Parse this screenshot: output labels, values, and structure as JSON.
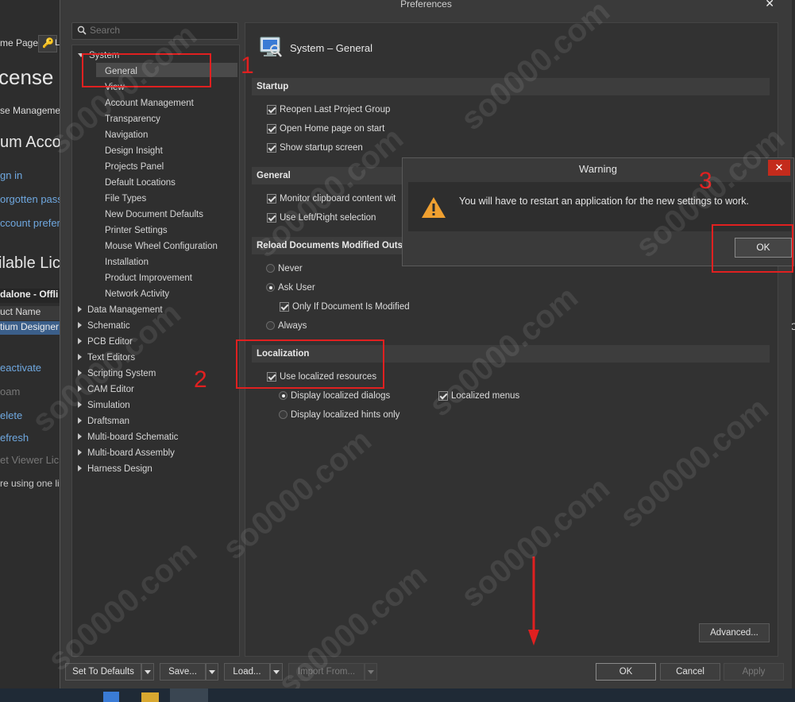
{
  "background_app": {
    "items": [
      "me Page",
      "L",
      "cense M",
      "se Managemen",
      "um Accou",
      "gn in",
      "orgotten pass",
      "ccount prefer",
      "ilable Lic",
      "dalone - Offli",
      "uct Name",
      "tium Designer",
      "eactivate",
      "oam",
      "elete",
      "efresh",
      "et Viewer Lic",
      "re using one li"
    ],
    "right_edge_text": "O"
  },
  "dialog": {
    "title": "Preferences",
    "close": "✕",
    "search_placeholder": "Search"
  },
  "tree": {
    "root": "System",
    "selected": "General",
    "system_children": [
      "General",
      "View",
      "Account Management",
      "Transparency",
      "Navigation",
      "Design Insight",
      "Projects Panel",
      "Default Locations",
      "File Types",
      "New Document Defaults",
      "Printer Settings",
      "Mouse Wheel Configuration",
      "Installation",
      "Product Improvement",
      "Network Activity"
    ],
    "groups": [
      "Data Management",
      "Schematic",
      "PCB Editor",
      "Text Editors",
      "Scripting System",
      "CAM Editor",
      "Simulation",
      "Draftsman",
      "Multi-board Schematic",
      "Multi-board Assembly",
      "Harness Design"
    ]
  },
  "page": {
    "heading": "System – General",
    "icon": "system-general-icon",
    "startup": {
      "header": "Startup",
      "options": [
        "Reopen Last Project Group",
        "Open Home page on start",
        "Show startup screen"
      ]
    },
    "general": {
      "header": "General",
      "options": [
        "Monitor clipboard content wit",
        "Use Left/Right selection"
      ]
    },
    "reload": {
      "header": "Reload Documents Modified Outsid",
      "never": "Never",
      "ask_user": "Ask User",
      "only_if": "Only If Document Is Modified",
      "always": "Always"
    },
    "localization": {
      "header": "Localization",
      "use_localized": "Use localized resources",
      "display_dialogs": "Display localized dialogs",
      "localized_menus": "Localized menus",
      "display_hints": "Display localized hints only"
    },
    "advanced_button": "Advanced..."
  },
  "footer": {
    "set_to_defaults": "Set To Defaults",
    "save": "Save...",
    "load": "Load...",
    "import_from": "Import From...",
    "ok": "OK",
    "cancel": "Cancel",
    "apply": "Apply"
  },
  "warning": {
    "title": "Warning",
    "message": "You will have to restart an application for the new settings to work.",
    "ok": "OK",
    "close": "✕",
    "icon": "warning-triangle-icon"
  },
  "annotations": {
    "n1": "1",
    "n2": "2",
    "n3": "3"
  },
  "watermark": "so0000.com",
  "colors": {
    "annotation_red": "#e02020",
    "warning_orange": "#f0a030",
    "close_red": "#c42b1c"
  }
}
